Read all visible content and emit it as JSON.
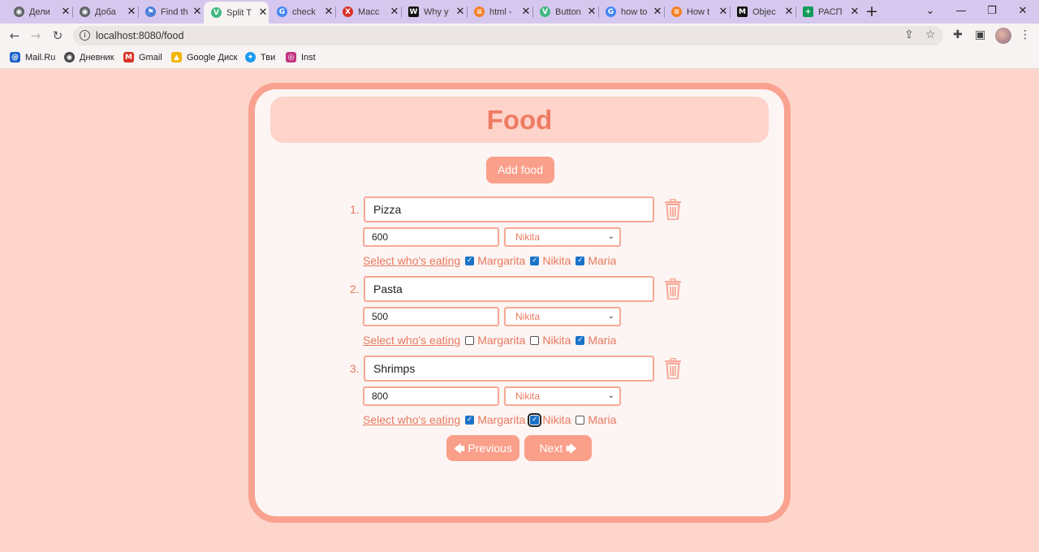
{
  "browser": {
    "tabs": [
      {
        "title": "Дели",
        "icon": "globe-icon",
        "color": "#5f6368",
        "glyph": "◉"
      },
      {
        "title": "Доба",
        "icon": "globe-icon",
        "color": "#5f6368",
        "glyph": "◉"
      },
      {
        "title": "Find th",
        "icon": "flag-icon",
        "color": "#4a7fd9",
        "glyph": "⚑"
      },
      {
        "title": "Split T",
        "icon": "vue-icon",
        "color": "#41b883",
        "glyph": "V",
        "active": true
      },
      {
        "title": "check",
        "icon": "google-icon",
        "color": "#4285f4",
        "glyph": "G"
      },
      {
        "title": "Масс",
        "icon": "figure-icon",
        "color": "#d93025",
        "glyph": "X"
      },
      {
        "title": "Why y",
        "icon": "dev-icon",
        "color": "#111111",
        "glyph": "W"
      },
      {
        "title": "html -",
        "icon": "stack-icon",
        "color": "#f48024",
        "glyph": "≡"
      },
      {
        "title": "Button",
        "icon": "vue-icon",
        "color": "#41b883",
        "glyph": "V"
      },
      {
        "title": "how to",
        "icon": "google-icon",
        "color": "#4285f4",
        "glyph": "G"
      },
      {
        "title": "How t",
        "icon": "stack-icon",
        "color": "#f48024",
        "glyph": "≡"
      },
      {
        "title": "Objec",
        "icon": "medium-icon",
        "color": "#111111",
        "glyph": "M"
      },
      {
        "title": "РАСП",
        "icon": "sheets-icon",
        "color": "#0f9d58",
        "glyph": "+"
      }
    ],
    "address": "localhost:8080/food",
    "bookmarks": [
      {
        "label": "Mail.Ru",
        "icon": "mail-icon",
        "color": "#1a63c8",
        "glyph": "@"
      },
      {
        "label": "Дневник",
        "icon": "globe-icon",
        "color": "#444444",
        "glyph": "◉"
      },
      {
        "label": "Gmail",
        "icon": "gmail-icon",
        "color": "#d93025",
        "glyph": "M"
      },
      {
        "label": "Google Диск",
        "icon": "drive-icon",
        "color": "#f4b400",
        "glyph": "▲"
      },
      {
        "label": "Тви",
        "icon": "twitter-icon",
        "color": "#1d9bf0",
        "glyph": "✦"
      },
      {
        "label": "Inst",
        "icon": "instagram-icon",
        "color": "#c13584",
        "glyph": "◎"
      }
    ]
  },
  "app": {
    "title": "Food",
    "add_button": "Add food",
    "select_label": "Select who's eating",
    "items": [
      {
        "num": "1.",
        "name": "Pizza",
        "price": "600",
        "payer": "Nikita",
        "eaters": [
          {
            "name": "Margarita",
            "checked": true
          },
          {
            "name": "Nikita",
            "checked": true
          },
          {
            "name": "Maria",
            "checked": true
          }
        ]
      },
      {
        "num": "2.",
        "name": "Pasta",
        "price": "500",
        "payer": "Nikita",
        "eaters": [
          {
            "name": "Margarita",
            "checked": false
          },
          {
            "name": "Nikita",
            "checked": false
          },
          {
            "name": "Maria",
            "checked": true
          }
        ]
      },
      {
        "num": "3.",
        "name": "Shrimps",
        "price": "800",
        "payer": "Nikita",
        "eaters": [
          {
            "name": "Margarita",
            "checked": true
          },
          {
            "name": "Nikita",
            "checked": true,
            "focused": true
          },
          {
            "name": "Maria",
            "checked": false
          }
        ]
      }
    ],
    "prev_button": "Previous",
    "next_button": "Next"
  },
  "colors": {
    "page_bg": "#fdd5cb",
    "accent": "#fa9f8a",
    "title": "#ee7b62",
    "text_accent": "#e97960",
    "checkbox": "#1a73c8"
  }
}
